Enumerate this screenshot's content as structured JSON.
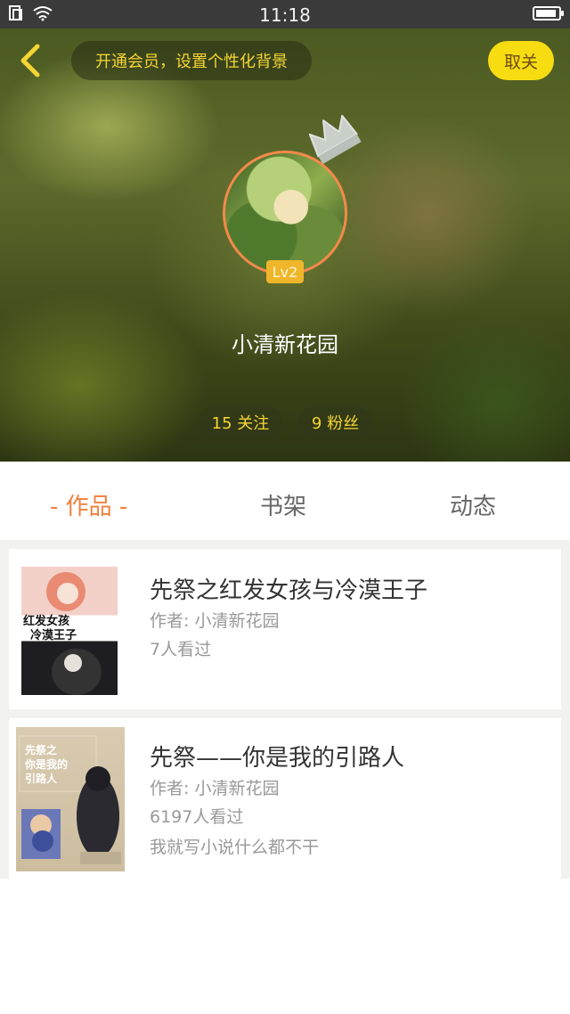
{
  "status_bar": {
    "time": "11:18",
    "battery_level": 0.9
  },
  "header": {
    "vip_prompt": "开通会员，设置个性化背景",
    "unfollow_label": "取关",
    "level_badge": "Lv2",
    "username": "小清新花园",
    "stats": {
      "following": "15 关注",
      "fans": "9 粉丝"
    },
    "icons": {
      "back": "back-chevron-icon",
      "crown": "crown-icon"
    },
    "colors": {
      "accent_yellow": "#f5d534",
      "button_yellow": "#f8dc12",
      "avatar_border": "#f28a4a",
      "badge": "#f0b62b"
    }
  },
  "tabs": {
    "items": [
      "- 作品 -",
      "书架",
      "动态"
    ],
    "active_index": 0,
    "active_color": "#f07f3c"
  },
  "books": [
    {
      "title": "先祭之红发女孩与冷漠王子",
      "author": "作者: 小清新花园",
      "views": "7人看过",
      "cover_text": [
        "红发女孩",
        "冷漠王子"
      ]
    },
    {
      "title": "先祭——你是我的引路人",
      "author": "作者: 小清新花园",
      "views": "6197人看过",
      "description": "我就写小说什么都不干",
      "cover_text": [
        "先祭之",
        "你是我的",
        "引路人"
      ]
    }
  ]
}
